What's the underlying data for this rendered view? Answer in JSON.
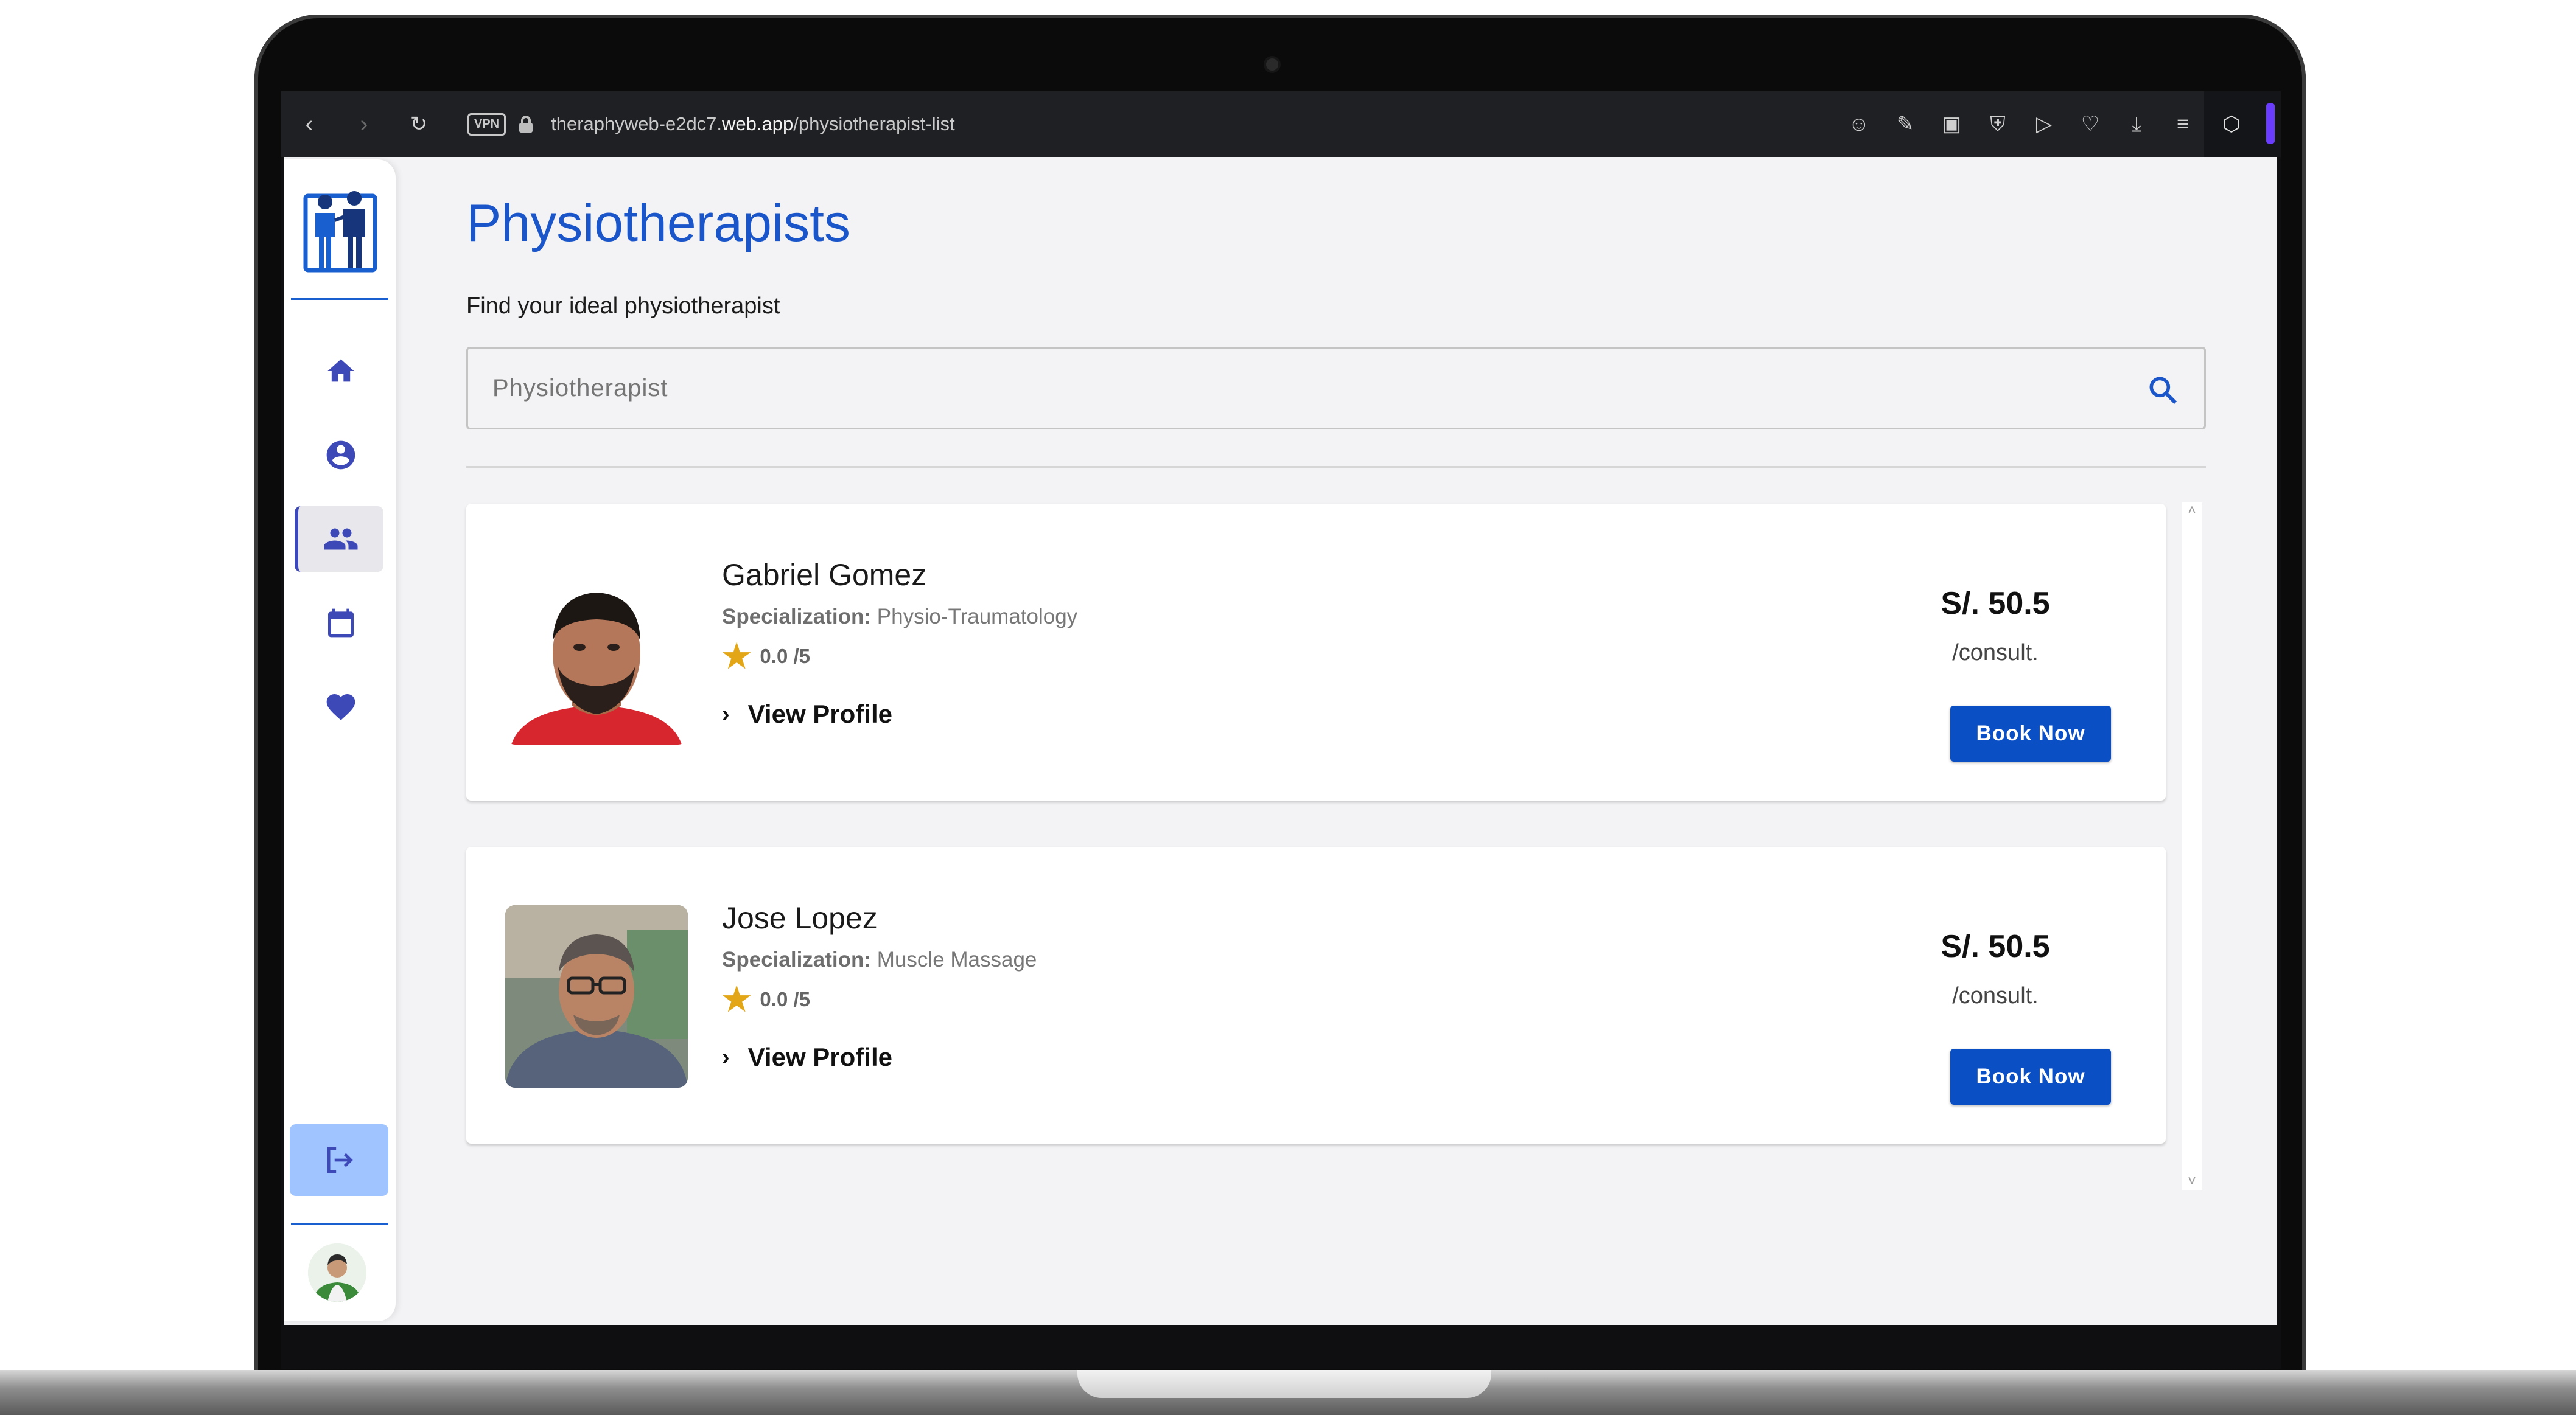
{
  "browser": {
    "vpn_label": "VPN",
    "url_host": "theraphyweb-e2dc7.",
    "url_domain": "web.app",
    "url_path": "/physiotherapist-list"
  },
  "page": {
    "title": "Physiotherapists",
    "subtitle": "Find your ideal physiotherapist",
    "search_placeholder": "Physiotherapist"
  },
  "therapists": [
    {
      "name": "Gabriel Gomez",
      "specialization_label": "Specialization:",
      "specialization": "Physio-Traumatology",
      "rating": "0.0 /5",
      "view_profile": "View Profile",
      "price": "S/. 50.5",
      "per": "/consult.",
      "book": "Book Now"
    },
    {
      "name": "Jose Lopez",
      "specialization_label": "Specialization:",
      "specialization": "Muscle Massage",
      "rating": "0.0 /5",
      "view_profile": "View Profile",
      "price": "S/. 50.5",
      "per": "/consult.",
      "book": "Book Now"
    }
  ],
  "colors": {
    "accent": "#1a56c9",
    "button": "#0a4fc4",
    "star": "#e2a617",
    "sidebar_icon": "#3e49b8",
    "logout_bg": "#9fc4ff"
  },
  "icons": {
    "nav": [
      "home-icon",
      "account-circle-icon",
      "group-icon",
      "calendar-icon",
      "heart-icon"
    ],
    "logout": "logout-icon",
    "search": "search-icon"
  }
}
